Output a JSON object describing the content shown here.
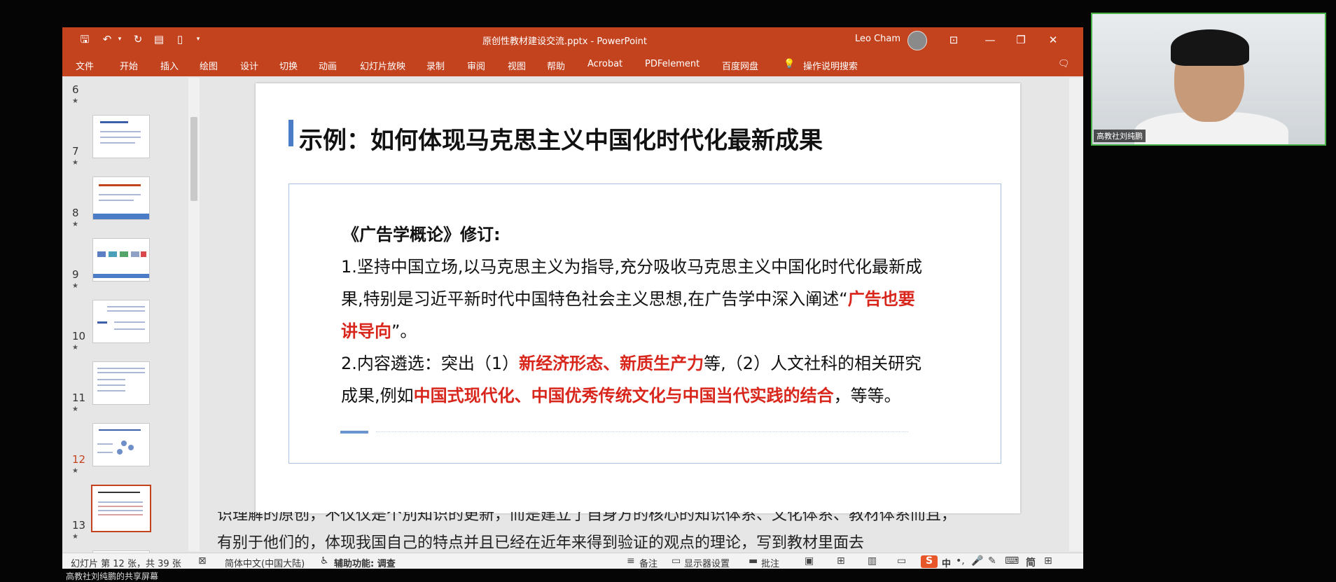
{
  "window": {
    "doc_title": "原创性教材建设交流.pptx  -  PowerPoint",
    "user_name": "Leo Cham",
    "menu": [
      "文件",
      "开始",
      "插入",
      "绘图",
      "设计",
      "切换",
      "动画",
      "幻灯片放映",
      "录制",
      "审阅",
      "视图",
      "帮助",
      "Acrobat",
      "PDFelement",
      "百度网盘"
    ],
    "tell_me": "操作说明搜索"
  },
  "thumbnails": [
    {
      "num": "6"
    },
    {
      "num": "7"
    },
    {
      "num": "8"
    },
    {
      "num": "9"
    },
    {
      "num": "10"
    },
    {
      "num": "11"
    },
    {
      "num": "12",
      "selected": true
    },
    {
      "num": "13"
    }
  ],
  "slide": {
    "title": "示例：如何体现马克思主义中国化时代化最新成果",
    "subtitle": "《广告学概论》修订:",
    "line1": "1.坚持中国立场,以马克思主义为指导,充分吸收马克思主义中国化时代化最新成",
    "line2_a": "果,特别是习近平新时代中国特色社会主义思想,在广告学中深入阐述“",
    "line2_red": "广告也要",
    "line3_red": "讲导向",
    "line3_b": "”。",
    "line4_a": "2.内容遴选：突出（1）",
    "line4_red": "新经济形态、新质生产力",
    "line4_b": "等,（2）人文社科的相关研究",
    "line5_a": "成果,例如",
    "line5_red": "中国式现代化、中国优秀传统文化与中国当代实践的结合",
    "line5_b": "，等等。"
  },
  "caption": {
    "line1": "识理解的原创，不仅仅是个別知识的更新，而是建立了自身方的核心的知识体系、文化体系、教材体系而且，",
    "line2": "有别于他们的，体现我国自己的特点并且已经在近年来得到验证的观点的理论，写到教材里面去"
  },
  "status": {
    "slide_info": "幻灯片 第 12 张，共 39 张",
    "language": "简体中文(中国大陆)",
    "accessibility": "辅助功能: 调查",
    "notes": "备注",
    "display": "显示器设置",
    "comments": "批注",
    "ime_zh": "中"
  },
  "webcam": {
    "label": "高教社刘纯鹏"
  },
  "share_label": "高教社刘纯鹏的共享屏幕",
  "colors": {
    "ribbon": "#c4431f",
    "accent_blue": "#4a7cc7",
    "highlight_red": "#d9261c",
    "webcam_border": "#49b34a"
  }
}
